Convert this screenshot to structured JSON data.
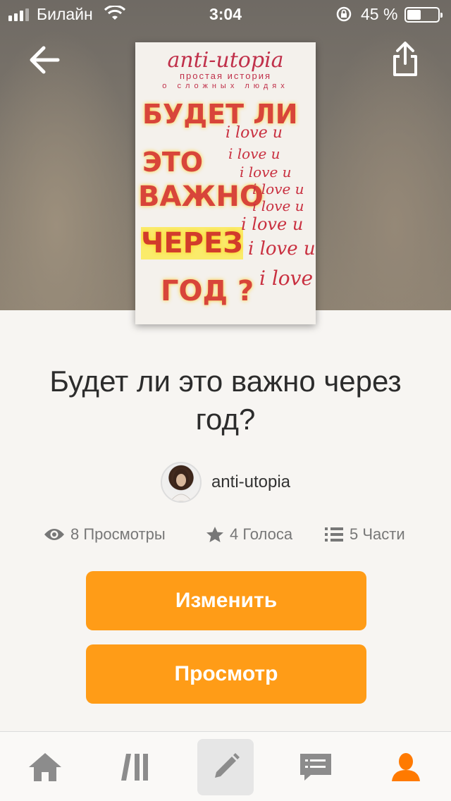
{
  "status_bar": {
    "carrier": "Билайн",
    "time": "3:04",
    "battery_percent": "45 %",
    "battery_level": 0.45
  },
  "cover": {
    "brand": "anti-utopia",
    "subtitle": "простая история",
    "subtitle2": "о сложных людях",
    "line1": "БУДЕТ ЛИ",
    "line2": "ЭТО",
    "line3": "ВАЖНО",
    "line4": "ЧЕРЕЗ",
    "line5": "ГОД ?",
    "love": "i love u",
    "love_tail": "i love"
  },
  "book": {
    "title": "Будет ли это важно через год?",
    "author": "anti-utopia"
  },
  "stats": {
    "views": "8 Просмотры",
    "votes": "4 Голоса",
    "parts": "5 Части"
  },
  "actions": {
    "edit_label": "Изменить",
    "view_label": "Просмотр"
  },
  "colors": {
    "accent": "#ff9c17",
    "active_tab": "#ff7a00",
    "inactive_tab": "#8c8c8c"
  },
  "icons": {
    "back": "arrow-left-icon",
    "share": "share-icon",
    "views": "eye-icon",
    "votes": "star-icon",
    "parts": "list-icon",
    "tab_home": "home-icon",
    "tab_library": "library-icon",
    "tab_write": "pencil-icon",
    "tab_messages": "chat-icon",
    "tab_profile": "profile-icon"
  }
}
